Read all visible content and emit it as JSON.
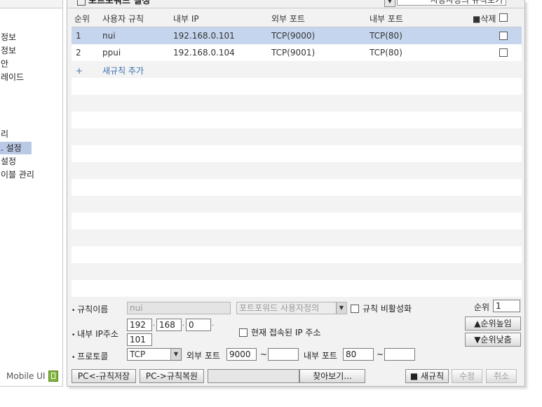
{
  "sidebar": {
    "items": [
      {
        "label": "정보"
      },
      {
        "label": "정보"
      },
      {
        "label": "안"
      },
      {
        "label": "레이드"
      },
      {
        "label": "리"
      },
      {
        "label": ". 설정"
      },
      {
        "label": "설정"
      },
      {
        "label": "이블 관리"
      }
    ],
    "mobile_label": "Mobile UI"
  },
  "header": {
    "title": "포트포워드 설정",
    "view_select": "사용자정의 규칙보기"
  },
  "table": {
    "columns": {
      "order": "순위",
      "user_rule": "사용자 규칙",
      "internal_ip": "내부 IP",
      "external_port": "외부 포트",
      "internal_port": "내부 포트",
      "delete": "■삭제"
    },
    "rows": [
      {
        "order": "1",
        "name": "nui",
        "internal_ip": "192.168.0.101",
        "external_port": "TCP(9000)",
        "internal_port": "TCP(80)"
      },
      {
        "order": "2",
        "name": "ppui",
        "internal_ip": "192.168.0.104",
        "external_port": "TCP(9001)",
        "internal_port": "TCP(80)"
      }
    ],
    "add_rule_plus": "+",
    "add_rule_label": "새규칙 추가"
  },
  "form": {
    "rule_name_label": "규칙이름",
    "rule_name_value": "nui",
    "rule_type_select": "포트포워드 사용자정의",
    "disable_rule_label": "규칙 비활성화",
    "order_label": "순위",
    "order_value": "1",
    "internal_ip_label": "내부 IP주소",
    "ip1": "192",
    "ip2": "168",
    "ip3": "0",
    "ip4": "101",
    "current_ip_label": "현재 접속된 IP 주소",
    "priority_up": "▲순위높임",
    "priority_down": "▼순위낮춤",
    "protocol_label": "프로토콜",
    "protocol_value": "TCP",
    "external_port_label": "외부 포트",
    "external_port_from": "9000",
    "external_port_to": "",
    "internal_port_label": "내부 포트",
    "internal_port_from": "80",
    "internal_port_to": "",
    "tilde": "~"
  },
  "buttons": {
    "save_to_pc": "PC<-규칙저장",
    "restore_from_pc": "PC->규칙복원",
    "browse": "찾아보기...",
    "new_rule": "■ 새규칙",
    "modify": "수정",
    "cancel": "취소"
  }
}
